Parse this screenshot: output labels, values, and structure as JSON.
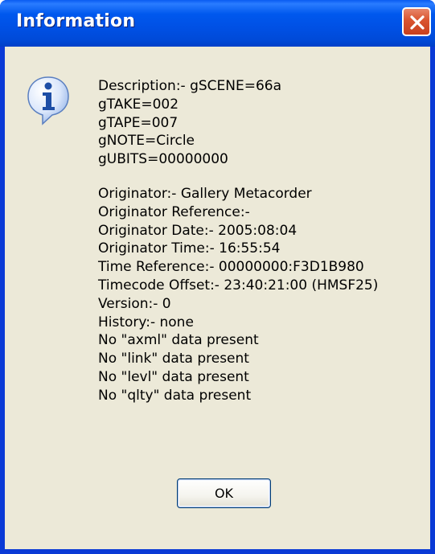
{
  "window": {
    "title": "Information",
    "close_icon": "close-icon"
  },
  "dialog": {
    "icon": "information-icon",
    "block1": [
      "Description:- gSCENE=66a",
      "gTAKE=002",
      "gTAPE=007",
      "gNOTE=Circle",
      "gUBITS=00000000"
    ],
    "block2": [
      "Originator:- Gallery Metacorder",
      "Originator Reference:-",
      "Originator Date:- 2005:08:04",
      "Originator Time:- 16:55:54",
      "Time Reference:- 00000000:F3D1B980",
      "Timecode Offset:- 23:40:21:00 (HMSF25)",
      "Version:- 0",
      "History:- none",
      "No \"axml\" data present",
      "No \"link\" data present",
      "No \"levl\" data present",
      "No \"qlty\" data present"
    ],
    "ok_label": "OK"
  },
  "colors": {
    "titlebar": "#0058ee",
    "client_bg": "#ece9d8",
    "close_red": "#d9532e"
  }
}
